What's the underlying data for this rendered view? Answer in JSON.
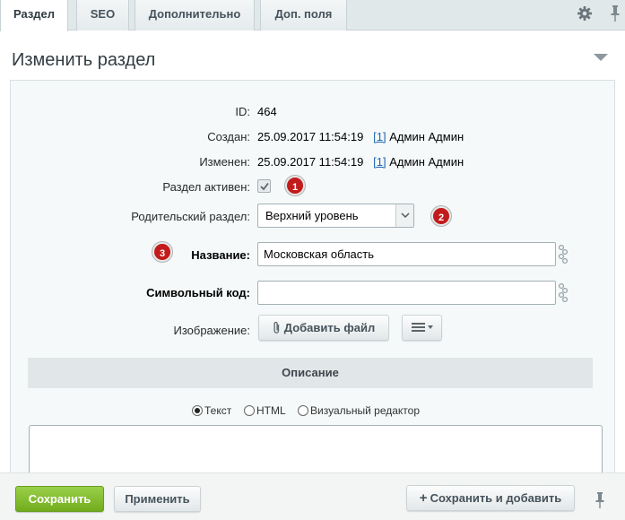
{
  "tabs": [
    {
      "label": "Раздел",
      "active": true
    },
    {
      "label": "SEO",
      "active": false
    },
    {
      "label": "Дополнительно",
      "active": false
    },
    {
      "label": "Доп. поля",
      "active": false
    }
  ],
  "icons": {
    "settings": "gear-icon",
    "pin": "pin-icon",
    "collapse": "triangle-down-icon",
    "attach": "paperclip-icon",
    "menu": "hamburger-icon",
    "translit": "chain-link-icon",
    "add": "plus-icon"
  },
  "header": {
    "title": "Изменить раздел"
  },
  "form": {
    "id": {
      "label": "ID:",
      "value": "464"
    },
    "created": {
      "label": "Создан:",
      "date": "25.09.2017 11:54:19",
      "user_link": "[1]",
      "user_name": "Админ Админ"
    },
    "modified": {
      "label": "Изменен:",
      "date": "25.09.2017 11:54:19",
      "user_link": "[1]",
      "user_name": "Админ Админ"
    },
    "active": {
      "label": "Раздел активен:",
      "checked": true
    },
    "parent": {
      "label": "Родительский раздел:",
      "selected": "Верхний уровень"
    },
    "name": {
      "label": "Название:",
      "value": "Московская область"
    },
    "code": {
      "label": "Символьный код:",
      "value": ""
    },
    "image": {
      "label": "Изображение:",
      "add_file_label": "Добавить файл"
    }
  },
  "badges": [
    "1",
    "2",
    "3"
  ],
  "description": {
    "section_title": "Описание",
    "modes": [
      {
        "label": "Текст",
        "selected": true
      },
      {
        "label": "HTML",
        "selected": false
      },
      {
        "label": "Визуальный редактор",
        "selected": false
      }
    ]
  },
  "footer": {
    "save_label": "Сохранить",
    "apply_label": "Применить",
    "save_add_label": "Сохранить и добавить"
  },
  "colors": {
    "accent_green": "#7ab32e",
    "badge_red": "#c21b1b",
    "link_blue": "#2067b0",
    "tabbar_bg": "#e0e8ea"
  }
}
